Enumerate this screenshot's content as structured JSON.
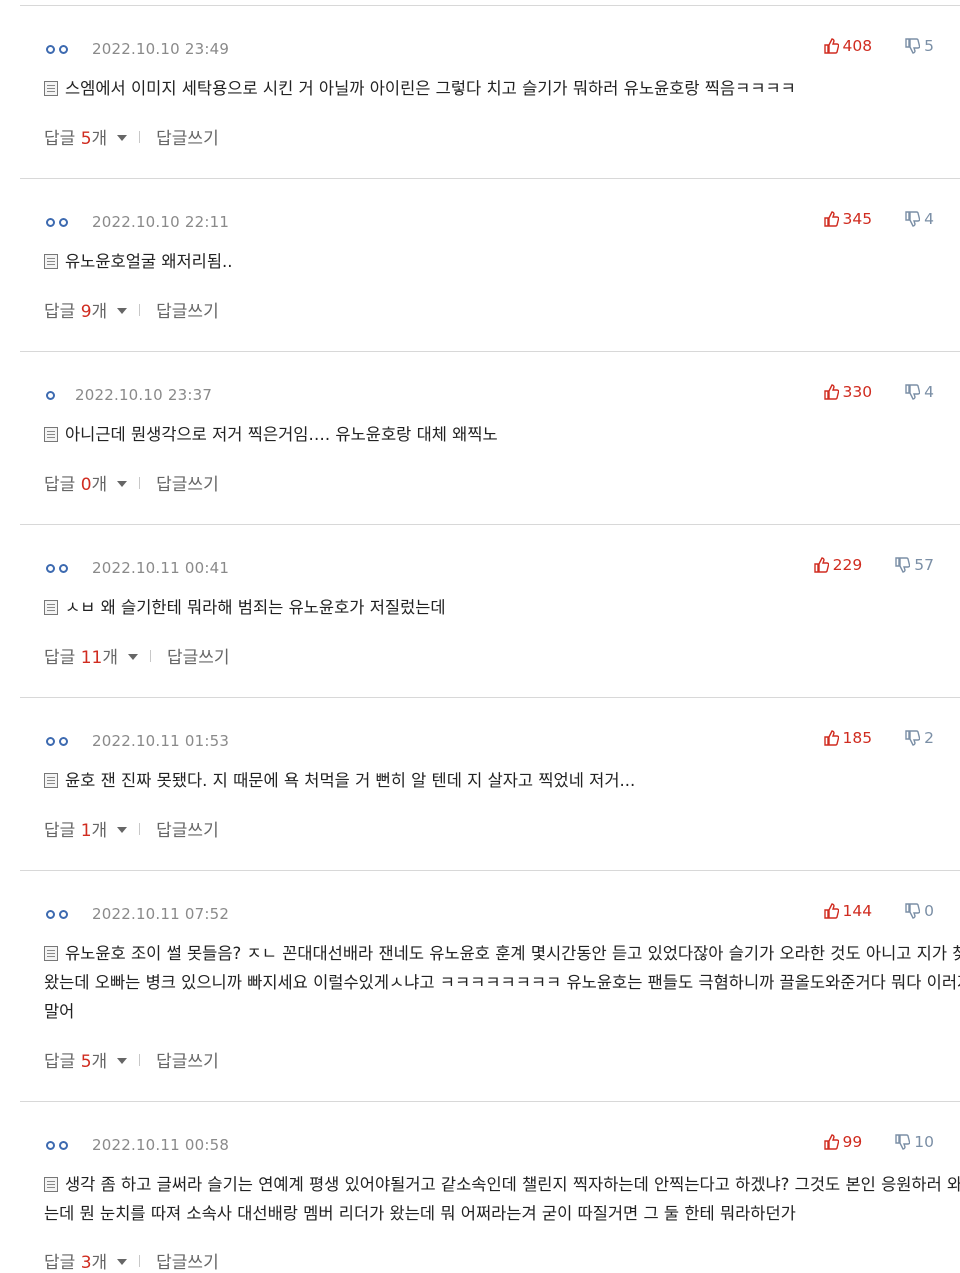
{
  "labels": {
    "reply_prefix": "답글 ",
    "reply_suffix": "개",
    "write_reply": "답글쓰기"
  },
  "colors": {
    "up": "#d02c20",
    "down": "#7b8fa6",
    "nick_dot": "#3d6ab0"
  },
  "comments": [
    {
      "date": "2022.10.10 23:49",
      "up": "408",
      "down": "5",
      "text": "스엠에서 이미지 세탁용으로 시킨 거 아닐까 아이린은 그렇다 치고 슬기가 뭐하러 유노윤호랑 찍음ㅋㅋㅋㅋ",
      "replies": "5"
    },
    {
      "date": "2022.10.10 22:11",
      "up": "345",
      "down": "4",
      "text": "유노윤호얼굴 왜저리됨..",
      "replies": "9"
    },
    {
      "date": "2022.10.10 23:37",
      "up": "330",
      "down": "4",
      "text": "아니근데 뭔생각으로 저거 찍은거임…. 유노윤호랑 대체 왜찍노",
      "replies": "0"
    },
    {
      "date": "2022.10.11 00:41",
      "up": "229",
      "down": "57",
      "text": "ㅅㅂ 왜 슬기한테 뭐라해 범죄는 유노윤호가 저질렀는데",
      "replies": "11"
    },
    {
      "date": "2022.10.11 01:53",
      "up": "185",
      "down": "2",
      "text": "윤호 잰 진짜 못됐다. 지 때문에 욕 처먹을 거 뻔히 알 텐데 지 살자고 찍었네 저거...",
      "replies": "1"
    },
    {
      "date": "2022.10.11 07:52",
      "up": "144",
      "down": "0",
      "text": "유노윤호 조이 썰 못들음? ㅈㄴ 꼰대대선배라 잰네도 유노윤호 훈계 몇시간동안 듣고 있었다잖아 슬기가 오라한 것도 아니고 지가 찾아왔는데 오빠는 병크 있으니까 빠지세요 이럴수있게ㅅ냐고 ㅋㅋㅋㅋㅋㅋㅋㅋ 유노윤호는 팬들도 극혐하니까 끌올도와준거다 뭐다 이러지말어",
      "replies": "5"
    },
    {
      "date": "2022.10.11 00:58",
      "up": "99",
      "down": "10",
      "text": "생각 좀 하고 글써라 슬기는 연예계 평생 있어야될거고 같소속인데 챌린지 찍자하는데 안찍는다고 하겠냐? 그것도 본인 응원하러 와줬는데 뭔 눈치를 따져 소속사 대선배랑 멤버 리더가 왔는데 뭐 어쩌라는겨 굳이 따질거면 그 둘 한테 뭐라하던가",
      "replies": "3"
    }
  ]
}
